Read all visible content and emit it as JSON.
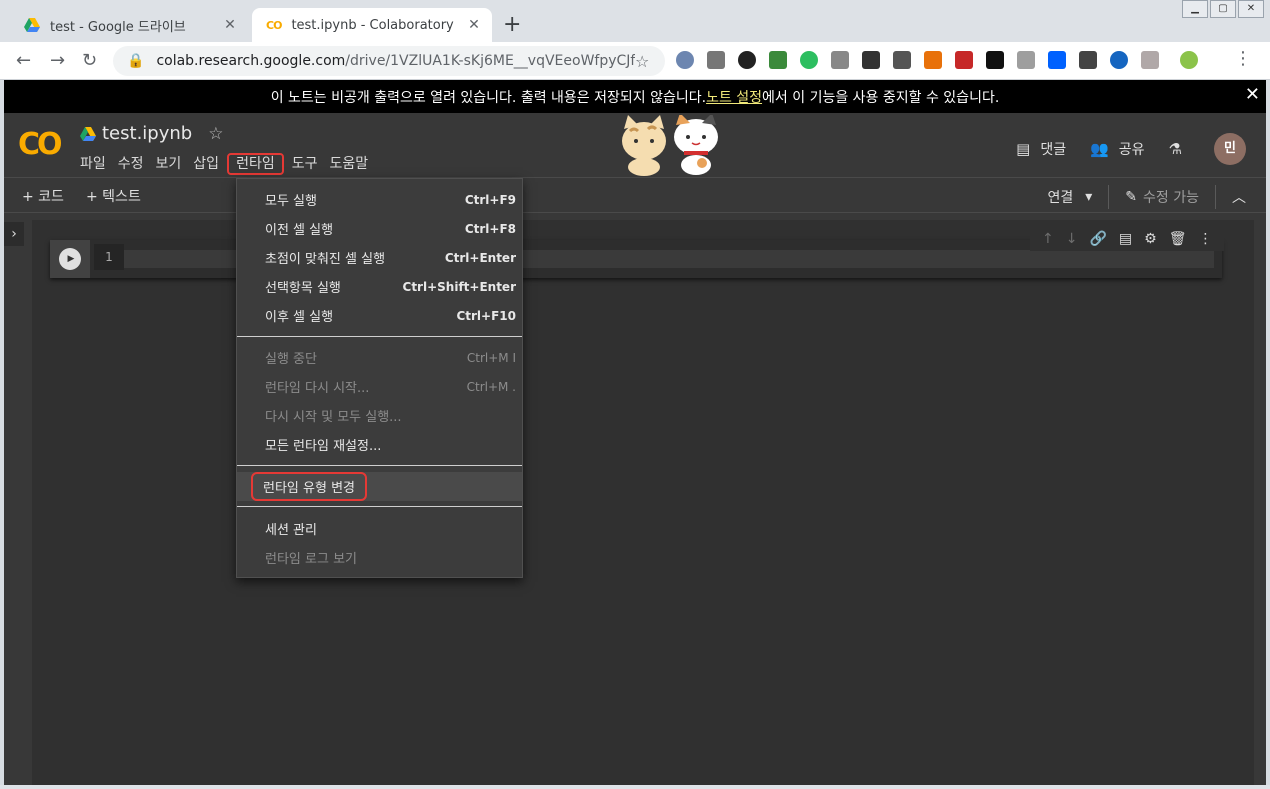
{
  "browser": {
    "tabs": [
      {
        "title": "test - Google 드라이브",
        "active": false
      },
      {
        "title": "test.ipynb - Colaboratory",
        "active": true
      }
    ],
    "new_tab": "+",
    "url_host": "colab.research.google.com",
    "url_path": "/drive/1VZlUA1K-sKj6ME__vqVEeoWfpyCJfKGQ..."
  },
  "banner": {
    "text_before": "이 노트는 비공개 출력으로 열려 있습니다. 출력 내용은 저장되지 않습니다. ",
    "link": "노트 설정",
    "text_after": "에서 이 기능을 사용 중지할 수 있습니다."
  },
  "header": {
    "logo": "CO",
    "title": "test.ipynb",
    "menu": [
      "파일",
      "수정",
      "보기",
      "삽입",
      "런타임",
      "도구",
      "도움말"
    ],
    "comment_label": "댓글",
    "share_label": "공유",
    "avatar_initial": "민"
  },
  "cellbar": {
    "add_code": "+ 코드",
    "add_text": "+ 텍스트",
    "connect": "연결",
    "editable": "수정 가능"
  },
  "cell": {
    "line_number": "1"
  },
  "runtime_menu": {
    "items": [
      {
        "label": "모두 실행",
        "shortcut": "Ctrl+F9"
      },
      {
        "label": "이전 셀 실행",
        "shortcut": "Ctrl+F8"
      },
      {
        "label": "초점이 맞춰진 셀 실행",
        "shortcut": "Ctrl+Enter"
      },
      {
        "label": "선택항목 실행",
        "shortcut": "Ctrl+Shift+Enter"
      },
      {
        "label": "이후 셀 실행",
        "shortcut": "Ctrl+F10"
      },
      {
        "label": "실행 중단",
        "shortcut": "Ctrl+M I"
      },
      {
        "label": "런타임 다시 시작...",
        "shortcut": "Ctrl+M ."
      },
      {
        "label": "다시 시작 및 모두 실행..."
      },
      {
        "label": "모든 런타임 재설정..."
      },
      {
        "label": "런타임 유형 변경"
      },
      {
        "label": "세션 관리"
      },
      {
        "label": "런타임 로그 보기"
      }
    ]
  },
  "colors": {
    "accent_orange": "#f9ab00",
    "highlight_red": "#e53935",
    "banner_link": "#f1e97a",
    "dark_bg": "#383838"
  }
}
